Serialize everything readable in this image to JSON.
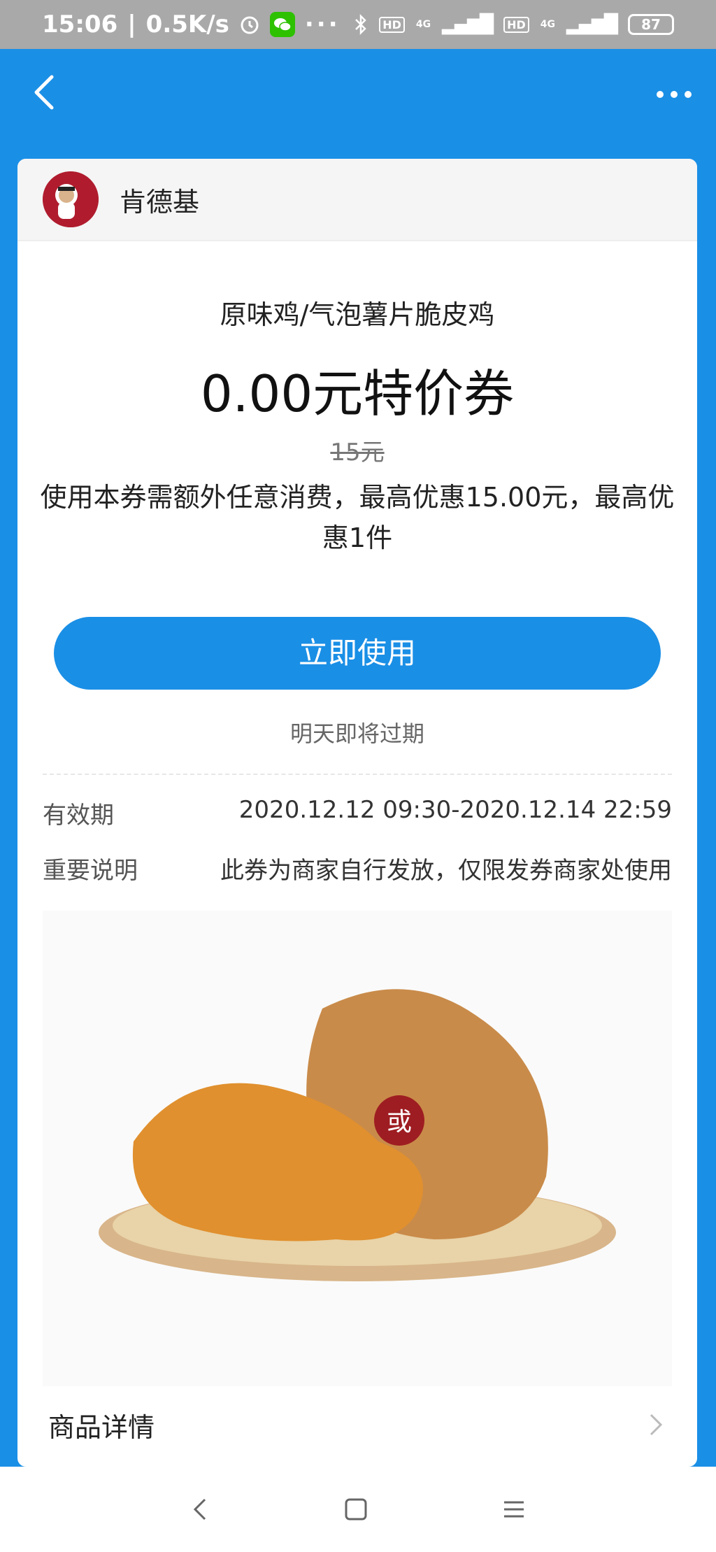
{
  "status": {
    "time": "15:06",
    "speed": "0.5K/s",
    "battery": "87",
    "hd": "HD",
    "network": "4G"
  },
  "merchant": {
    "name": "肯德基",
    "logo_text": "KFC"
  },
  "coupon": {
    "product": "原味鸡/气泡薯片脆皮鸡",
    "price": "0.00元特价券",
    "original_price": "15元",
    "description": "使用本券需额外任意消费，最高优惠15.00元，最高优惠1件",
    "use_button": "立即使用",
    "expire_note": "明天即将过期"
  },
  "info": [
    {
      "label": "有效期",
      "value": "2020.12.12 09:30-2020.12.14 22:59"
    },
    {
      "label": "重要说明",
      "value": "此券为商家自行发放，仅限发券商家处使用"
    }
  ],
  "image": {
    "or_badge": "或"
  },
  "details": {
    "label": "商品详情"
  },
  "colors": {
    "primary": "#1a8fe6",
    "status_bar": "#a9a9a9",
    "kfc_red": "#b01c2e"
  }
}
